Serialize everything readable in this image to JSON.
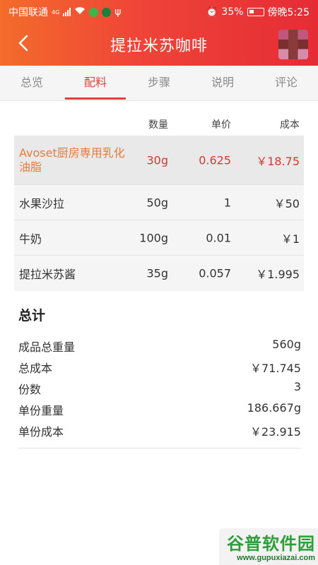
{
  "status_bar": {
    "carrier": "中国联通",
    "network": "4G",
    "battery": "35%",
    "time": "傍晚5:25"
  },
  "header": {
    "title": "提拉米苏咖啡"
  },
  "tabs": [
    "总览",
    "配料",
    "步骤",
    "说明",
    "评论"
  ],
  "active_tab": "配料",
  "table": {
    "headers": {
      "qty": "数量",
      "price": "单价",
      "cost": "成本"
    },
    "rows": [
      {
        "name": "Avoset厨房専用乳化油脂",
        "qty": "30g",
        "price": "0.625",
        "cost": "￥18.75"
      },
      {
        "name": "水果沙拉",
        "qty": "50g",
        "price": "1",
        "cost": "￥50"
      },
      {
        "name": "牛奶",
        "qty": "100g",
        "price": "0.01",
        "cost": "￥1"
      },
      {
        "name": "提拉米苏酱",
        "qty": "35g",
        "price": "0.057",
        "cost": "￥1.995"
      }
    ]
  },
  "summary": {
    "title": "总计",
    "items": [
      {
        "label": "成品总重量",
        "value": "560g"
      },
      {
        "label": "总成本",
        "value": "￥71.745"
      },
      {
        "label": "份数",
        "value": "3"
      },
      {
        "label": "单份重量",
        "value": "186.667g"
      },
      {
        "label": "单份成本",
        "value": "￥23.915"
      }
    ]
  },
  "watermark": {
    "logo": "谷普软件园",
    "url": "www.gupuxiazai.com"
  }
}
